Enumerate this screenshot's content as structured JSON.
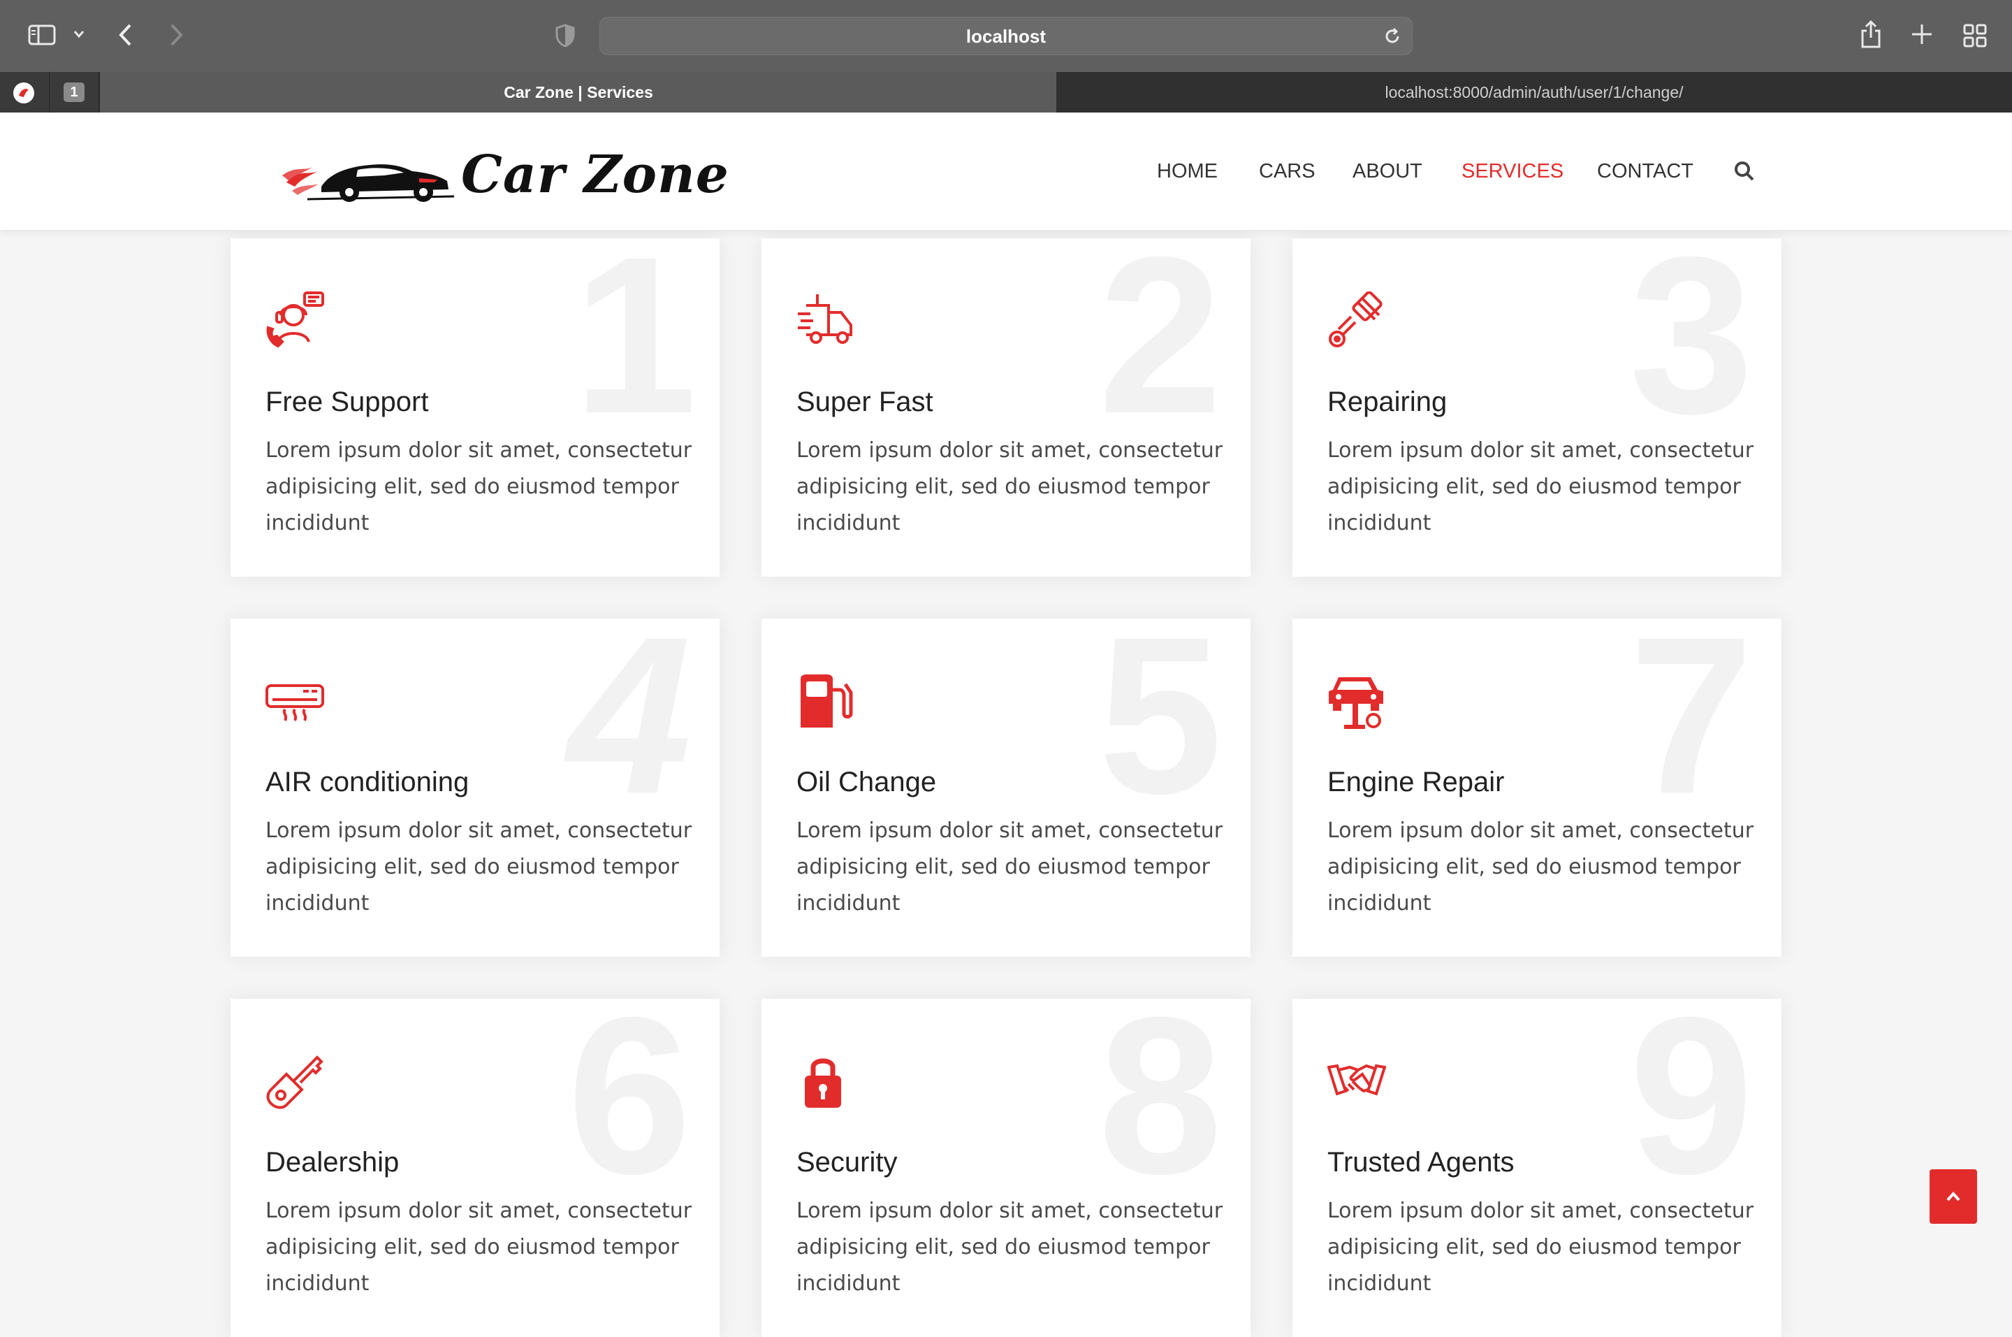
{
  "browser": {
    "address": "localhost",
    "tabs": [
      {
        "label": "Car Zone | Services",
        "active": true
      },
      {
        "label": "localhost:8000/admin/auth/user/1/change/",
        "active": false
      }
    ],
    "tab_count_badge": "1"
  },
  "brand": {
    "name": "Car Zone",
    "accent": "#e22c2c"
  },
  "nav": {
    "items": [
      {
        "label": "HOME"
      },
      {
        "label": "CARS"
      },
      {
        "label": "ABOUT"
      },
      {
        "label": "SERVICES",
        "active": true
      },
      {
        "label": "CONTACT"
      }
    ],
    "search_icon": "search-icon"
  },
  "services": [
    {
      "number": "1",
      "title": "Free Support",
      "desc": "Lorem ipsum dolor sit amet, consectetur adipisicing elit, sed do eiusmod tempor incididunt",
      "icon": "support-agent-icon"
    },
    {
      "number": "2",
      "title": "Super Fast",
      "desc": "Lorem ipsum dolor sit amet, consectetur adipisicing elit, sed do eiusmod tempor incididunt",
      "icon": "fast-truck-icon"
    },
    {
      "number": "3",
      "title": "Repairing",
      "desc": "Lorem ipsum dolor sit amet, consectetur adipisicing elit, sed do eiusmod tempor incididunt",
      "icon": "piston-icon"
    },
    {
      "number": "4",
      "title": "AIR conditioning",
      "desc": "Lorem ipsum dolor sit amet, consectetur adipisicing elit, sed do eiusmod tempor incididunt",
      "icon": "air-conditioner-icon"
    },
    {
      "number": "5",
      "title": "Oil Change",
      "desc": "Lorem ipsum dolor sit amet, consectetur adipisicing elit, sed do eiusmod tempor incididunt",
      "icon": "fuel-pump-icon"
    },
    {
      "number": "7",
      "title": "Engine Repair",
      "desc": "Lorem ipsum dolor sit amet, consectetur adipisicing elit, sed do eiusmod tempor incididunt",
      "icon": "car-lift-icon"
    },
    {
      "number": "6",
      "title": "Dealership",
      "desc": "Lorem ipsum dolor sit amet, consectetur adipisicing elit, sed do eiusmod tempor incididunt",
      "icon": "car-key-icon"
    },
    {
      "number": "8",
      "title": "Security",
      "desc": "Lorem ipsum dolor sit amet, consectetur adipisicing elit, sed do eiusmod tempor incididunt",
      "icon": "padlock-icon"
    },
    {
      "number": "9",
      "title": "Trusted Agents",
      "desc": "Lorem ipsum dolor sit amet, consectetur adipisicing elit, sed do eiusmod tempor incididunt",
      "icon": "handshake-icon"
    }
  ]
}
